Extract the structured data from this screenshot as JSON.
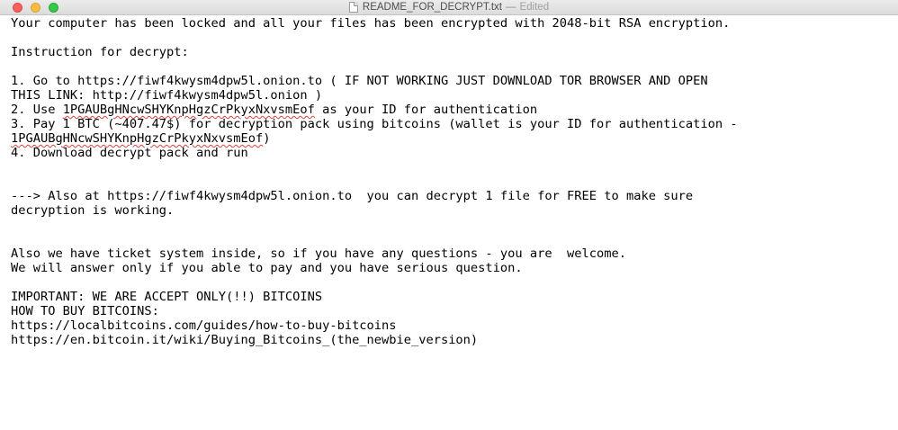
{
  "window": {
    "title": "README_FOR_DECRYPT.txt",
    "separator": "—",
    "status": "Edited"
  },
  "document": {
    "l1": "Your computer has been locked and all your files has been encrypted with 2048-bit RSA encryption.",
    "l2": "Instruction for decrypt:",
    "l3": "1. Go to https://fiwf4kwysm4dpw5l.onion.to ( IF NOT WORKING JUST DOWNLOAD TOR BROWSER AND OPEN",
    "l4": "THIS LINK: http://fiwf4kwysm4dpw5l.onion )",
    "l5a": "2. Use ",
    "l5id": "1PGAUBgHNcwSHYKnpHgzCrPkyxNxvsmEof",
    "l5b": " as your ID for authentication",
    "l6": "3. Pay 1 BTC (~407.47$) for decryption pack using bitcoins (wallet is your ID for authentication -",
    "l7id": "1PGAUBgHNcwSHYKnpHgzCrPkyxNxvsmEof",
    "l7b": ")",
    "l8": "4. Download decrypt pack and run",
    "l9": "---> Also at https://fiwf4kwysm4dpw5l.onion.to  you can decrypt 1 file for FREE to make sure",
    "l10": "decryption is working.",
    "l11": "Also we have ticket system inside, so if you have any questions - you are  welcome.",
    "l12": "We will answer only if you able to pay and you have serious question.",
    "l13": "IMPORTANT: WE ARE ACCEPT ONLY(!!) BITCOINS",
    "l14": "HOW TO BUY BITCOINS:",
    "l15": "https://localbitcoins.com/guides/how-to-buy-bitcoins",
    "l16": "https://en.bitcoin.it/wiki/Buying_Bitcoins_(the_newbie_version)"
  }
}
